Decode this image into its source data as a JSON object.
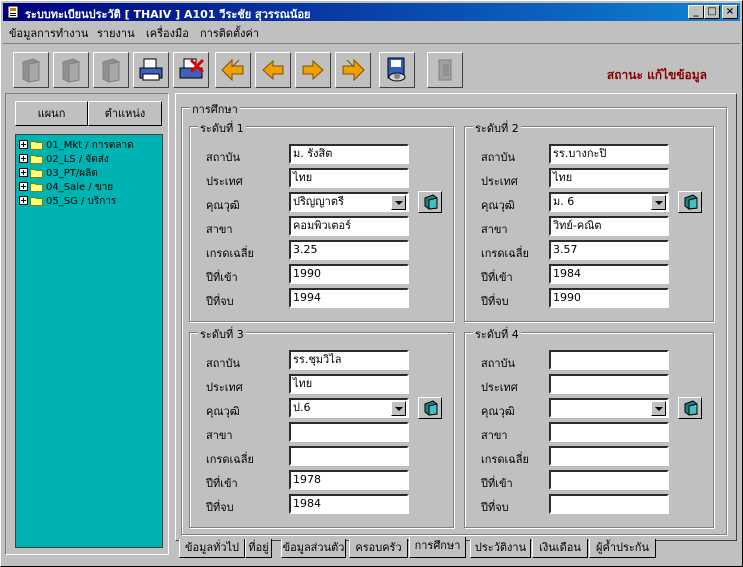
{
  "window": {
    "title": "ระบบทะเบียนประวัติ [ THAIV ]   A101   วีระชัย  สุวรรณน้อย",
    "controls": {
      "minimize": "_",
      "maximize": "□",
      "close": "×"
    }
  },
  "menu": [
    "ข้อมูลการทำงาน",
    "รายงาน",
    "เครื่องมือ",
    "การติดตั้งค่า"
  ],
  "toolbar": {
    "buttons": [
      {
        "name": "first-record",
        "icon": "book-icon",
        "enabled": false
      },
      {
        "name": "add",
        "icon": "book-icon",
        "enabled": false
      },
      {
        "name": "edit",
        "icon": "book-icon",
        "enabled": false
      },
      {
        "name": "print",
        "icon": "printer-icon",
        "enabled": true
      },
      {
        "name": "delete",
        "icon": "printer-delete-icon",
        "enabled": true
      },
      {
        "name": "first",
        "icon": "double-arrow-left-icon",
        "enabled": true
      },
      {
        "name": "prev",
        "icon": "arrow-left-icon",
        "enabled": true
      },
      {
        "name": "next",
        "icon": "arrow-right-icon",
        "enabled": true
      },
      {
        "name": "last",
        "icon": "double-arrow-right-icon",
        "enabled": true
      },
      {
        "name": "search",
        "icon": "disk-search-icon",
        "enabled": true
      },
      {
        "name": "exit",
        "icon": "exit-icon",
        "enabled": false
      }
    ],
    "status": "สถานะ แก้ไขข้อมูล",
    "status_color": "#8b0000"
  },
  "left": {
    "buttons": [
      "แผนก",
      "ตำแหน่ง"
    ],
    "tree_color": "#00b3b3",
    "tree": [
      "01_Mkt / การตลาด",
      "02_LS / จัดส่ง",
      "03_PT/ผลิต",
      "04_Sale / ขาย",
      "05_SG / บริการ"
    ]
  },
  "education": {
    "title": "การศึกษา",
    "labels": {
      "institution": "สถาบัน",
      "country": "ประเทศ",
      "degree": "คุณวุฒิ",
      "major": "สาขา",
      "gpa": "เกรดเฉลี่ย",
      "year_in": "ปีที่เข้า",
      "year_out": "ปีที่จบ"
    },
    "levels": [
      {
        "title": "ระดับที่ 1",
        "institution": "ม. รังสิต",
        "country": "ไทย",
        "degree": "ปริญญาตรี",
        "major": "คอมพิวเตอร์",
        "gpa": "3.25",
        "year_in": "1990",
        "year_out": "1994"
      },
      {
        "title": "ระดับที่ 2",
        "institution": "รร.บางกะปิ",
        "country": "ไทย",
        "degree": "ม. 6",
        "major": "วิทย์-คณิต",
        "gpa": "3.57",
        "year_in": "1984",
        "year_out": "1990"
      },
      {
        "title": "ระดับที่ 3",
        "institution": "รร.ชุมวิไล",
        "country": "ไทย",
        "degree": "ป.6",
        "major": "",
        "gpa": "",
        "year_in": "1978",
        "year_out": "1984"
      },
      {
        "title": "ระดับที่ 4",
        "institution": "",
        "country": "",
        "degree": "",
        "major": "",
        "gpa": "",
        "year_in": "",
        "year_out": ""
      }
    ]
  },
  "tabs": [
    {
      "label": "ข้อมูลทั่วไป",
      "active": false
    },
    {
      "label": "ที่อยู่",
      "active": false
    },
    {
      "label": "ข้อมูลส่วนตัว",
      "active": false
    },
    {
      "label": "ครอบครัว",
      "active": false
    },
    {
      "label": "การศึกษา",
      "active": true
    },
    {
      "label": "ประวัติงาน",
      "active": false
    },
    {
      "label": "เงินเดือน",
      "active": false
    },
    {
      "label": "ผู้ค้ำประกัน",
      "active": false
    }
  ]
}
